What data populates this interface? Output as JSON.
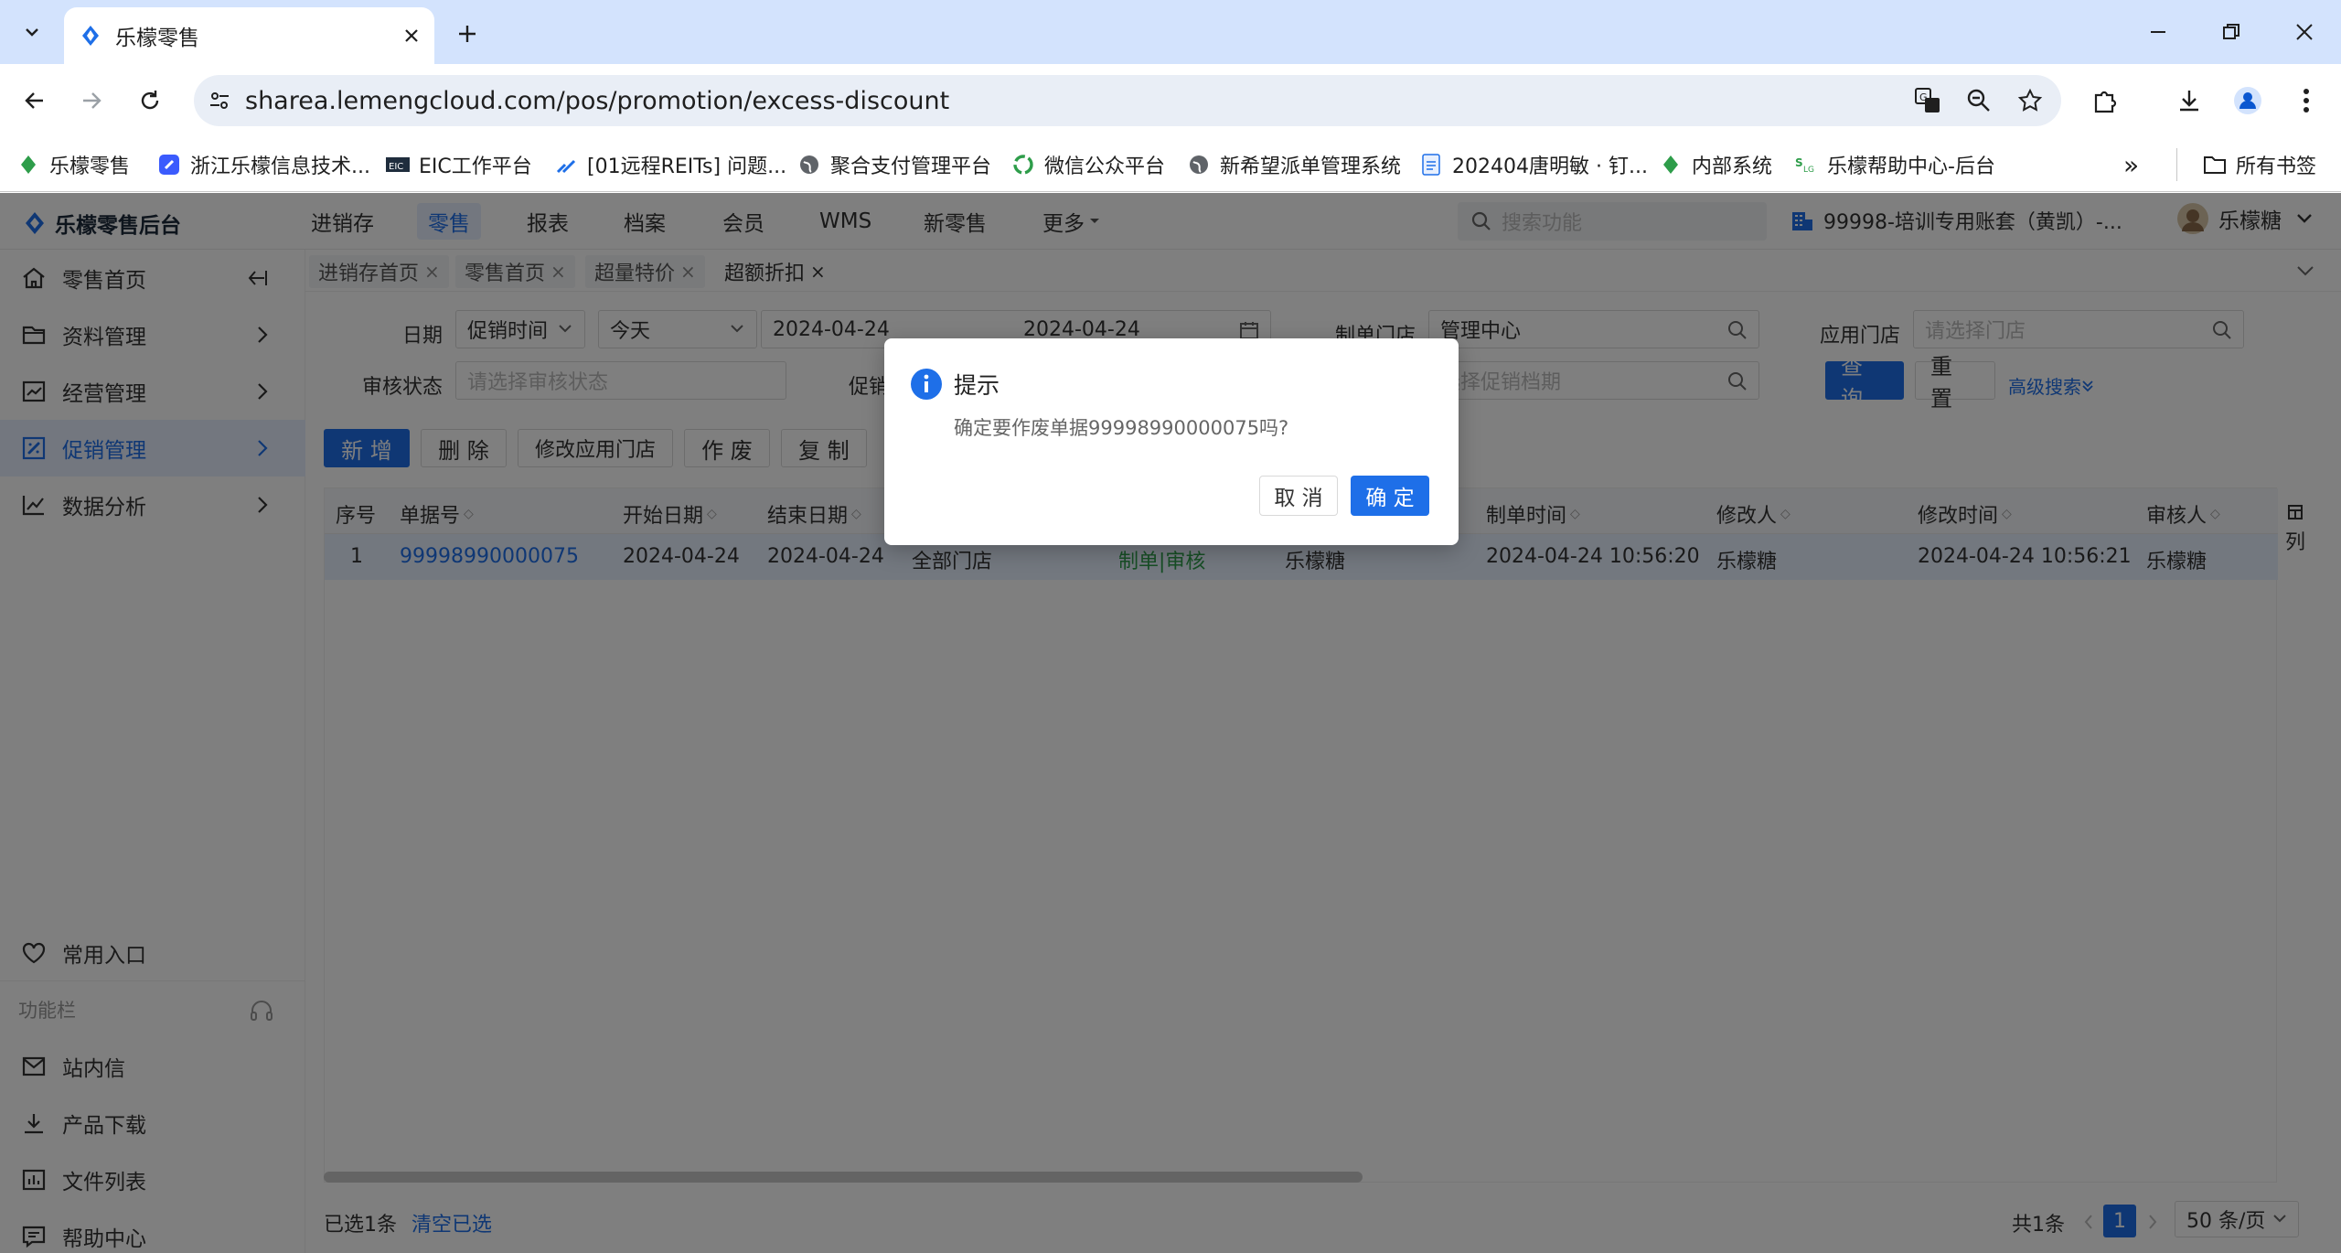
{
  "browser": {
    "tab_title": "乐檬零售",
    "url": "sharea.lemengcloud.com/pos/promotion/excess-discount",
    "bookmarks": [
      {
        "label": "乐檬零售",
        "icon": "lemeng-icon"
      },
      {
        "label": "浙江乐檬信息技术...",
        "icon": "lemeng-blue-icon"
      },
      {
        "label": "EIC工作平台",
        "icon": "eic-icon"
      },
      {
        "label": "[01远程REITs] 问题...",
        "icon": "jira-icon"
      },
      {
        "label": "聚合支付管理平台",
        "icon": "globe-icon"
      },
      {
        "label": "微信公众平台",
        "icon": "wechat-icon"
      },
      {
        "label": "新希望派单管理系统",
        "icon": "globe-icon"
      },
      {
        "label": "202404唐明敏 · 钉...",
        "icon": "doc-icon"
      },
      {
        "label": "内部系统",
        "icon": "lemeng-icon"
      },
      {
        "label": "乐檬帮助中心-后台",
        "icon": "help-logo-icon"
      }
    ],
    "more_bookmarks": "»",
    "all_bookmarks": "所有书签"
  },
  "app": {
    "logo_text": "乐檬零售后台",
    "menu": [
      "进销存",
      "零售",
      "报表",
      "档案",
      "会员",
      "WMS",
      "新零售",
      "更多"
    ],
    "active_menu": 1,
    "search_placeholder": "搜索功能",
    "account": "99998-培训专用账套（黄凯）-...",
    "user": "乐檬糖"
  },
  "sidebar": {
    "items": [
      {
        "label": "零售首页",
        "icon": "home-icon"
      },
      {
        "label": "资料管理",
        "icon": "folder-icon"
      },
      {
        "label": "经营管理",
        "icon": "chart-icon"
      },
      {
        "label": "促销管理",
        "icon": "promo-icon"
      },
      {
        "label": "数据分析",
        "icon": "trend-icon"
      }
    ],
    "active": 3,
    "favorites": "常用入口",
    "section": "功能栏",
    "tools": [
      {
        "label": "站内信",
        "icon": "mail-icon"
      },
      {
        "label": "产品下载",
        "icon": "download-icon"
      },
      {
        "label": "文件列表",
        "icon": "filelist-icon"
      },
      {
        "label": "帮助中心",
        "icon": "help-icon"
      }
    ]
  },
  "page_tabs": [
    {
      "label": "进销存首页",
      "close": "×"
    },
    {
      "label": "零售首页",
      "close": "×"
    },
    {
      "label": "超量特价",
      "close": "×"
    },
    {
      "label": "超额折扣",
      "close": "×"
    }
  ],
  "filters": {
    "date_label": "日期",
    "date_type": "促销时间",
    "date_range": "今天",
    "date_start": "2024-04-24",
    "date_end": "2024-04-24",
    "maker_store_label": "制单门店",
    "maker_store_value": "管理中心",
    "apply_store_label": "应用门店",
    "apply_store_placeholder": "请选择门店",
    "audit_label": "审核状态",
    "audit_placeholder": "请选择审核状态",
    "promo_label": "促销",
    "promo_placeholder": "选择促销档期",
    "query": "查 询",
    "reset": "重 置",
    "advanced": "高级搜索"
  },
  "actions": [
    "新 增",
    "删 除",
    "修改应用门店",
    "作 废",
    "复 制"
  ],
  "table": {
    "columns": [
      "序号",
      "单据号",
      "开始日期",
      "结束日期",
      "制单时间",
      "修改人",
      "修改时间",
      "审核人"
    ],
    "row": {
      "seq": "1",
      "doc_no": "99998990000075",
      "start": "2024-04-24",
      "end": "2024-04-24",
      "stores": "全部门店",
      "status": "制单|审核",
      "maker": "乐檬糖",
      "make_time": "2024-04-24 10:56:20",
      "modifier": "乐檬糖",
      "modify_time": "2024-04-24 10:56:21",
      "auditor": "乐檬糖"
    },
    "col_toggle": "列"
  },
  "footer": {
    "selected": "已选1条",
    "clear": "清空已选",
    "total": "共1条",
    "page": "1",
    "page_size": "50 条/页"
  },
  "dialog": {
    "title": "提示",
    "message": "确定要作废单据99998990000075吗?",
    "cancel": "取 消",
    "ok": "确 定"
  },
  "colors": {
    "primary": "#1e6fe8",
    "status_green": "#2e9d4a"
  }
}
